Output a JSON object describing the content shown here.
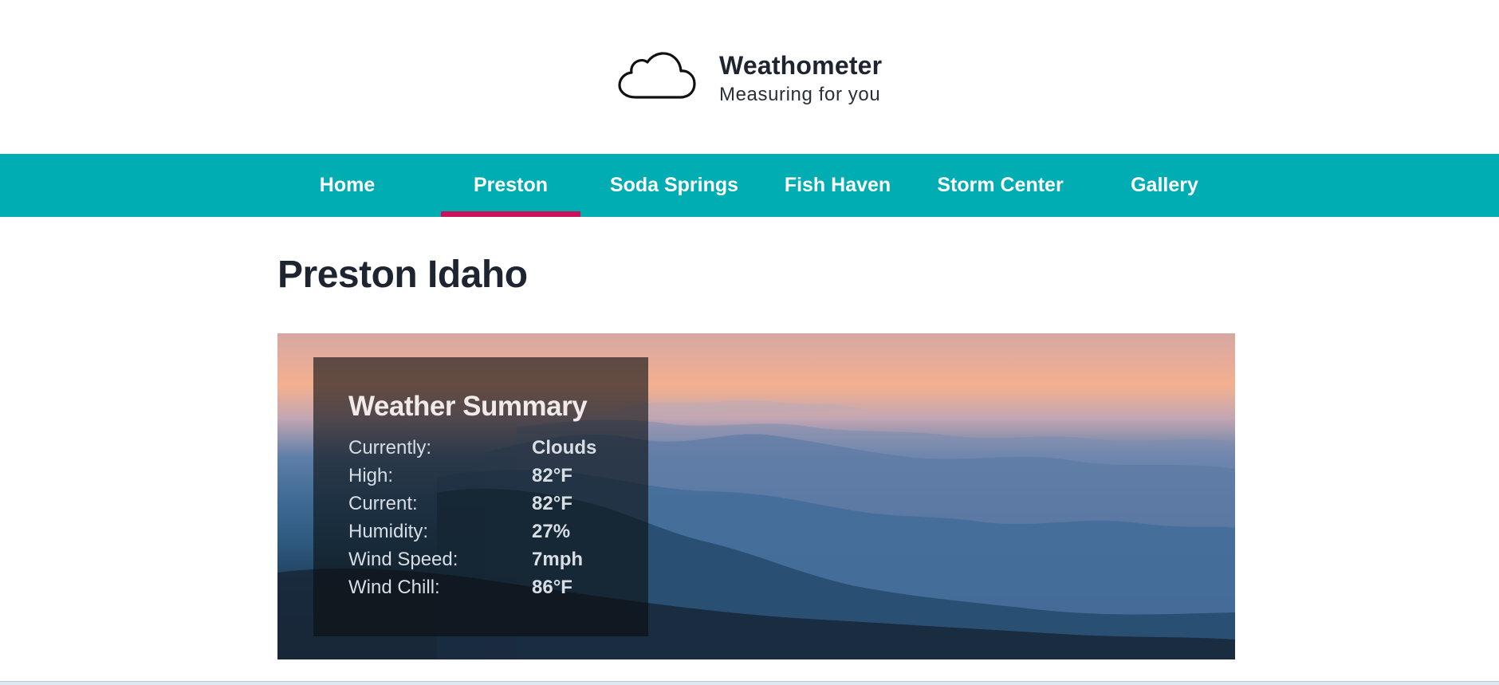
{
  "header": {
    "brand_name": "Weathometer",
    "tagline": "Measuring for you",
    "logo_icon": "cloud-icon"
  },
  "nav": {
    "items": [
      {
        "label": "Home"
      },
      {
        "label": "Preston"
      },
      {
        "label": "Soda Springs"
      },
      {
        "label": "Fish Haven"
      },
      {
        "label": "Storm Center"
      },
      {
        "label": "Gallery"
      }
    ],
    "active": "Preston",
    "colors": {
      "bar": "#00adb3",
      "active_underline": "#c8125b",
      "text": "#ffffff"
    }
  },
  "main": {
    "title": "Preston Idaho",
    "hero_image": "mountain-sunset-landscape",
    "summary": {
      "title": "Weather Summary",
      "rows": [
        {
          "label": "Currently:",
          "value": "Clouds"
        },
        {
          "label": "High:",
          "value": "82°F"
        },
        {
          "label": "Current:",
          "value": "82°F"
        },
        {
          "label": "Humidity:",
          "value": "27%"
        },
        {
          "label": "Wind Speed:",
          "value": "7mph"
        },
        {
          "label": "Wind Chill:",
          "value": "86°F"
        }
      ]
    }
  }
}
